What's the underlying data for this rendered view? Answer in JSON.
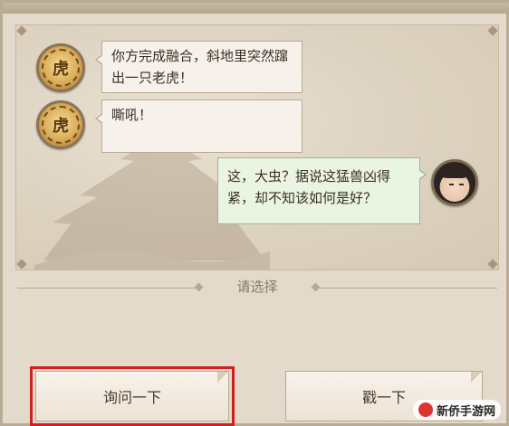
{
  "dialogue": {
    "lines": [
      {
        "speaker": "npc",
        "text": "你方完成融合，斜地里突然蹿出一只老虎！"
      },
      {
        "speaker": "npc",
        "text": "嘶吼！"
      },
      {
        "speaker": "player",
        "text": "这，大虫？据说这猛兽凶得紧，却不知该如何是好？"
      }
    ],
    "npc_avatar_icon": "tiger-emblem-icon",
    "player_avatar_icon": "hero-portrait-icon"
  },
  "prompt": {
    "label": "请选择"
  },
  "choices": [
    {
      "label": "询问一下",
      "selected": true
    },
    {
      "label": "戳一下",
      "selected": false
    }
  ],
  "watermark": {
    "text": "新侨手游网"
  },
  "colors": {
    "selection_outline": "#d21e1e",
    "player_bubble": "#eaf4e2",
    "npc_bubble": "#f6f1ea"
  }
}
